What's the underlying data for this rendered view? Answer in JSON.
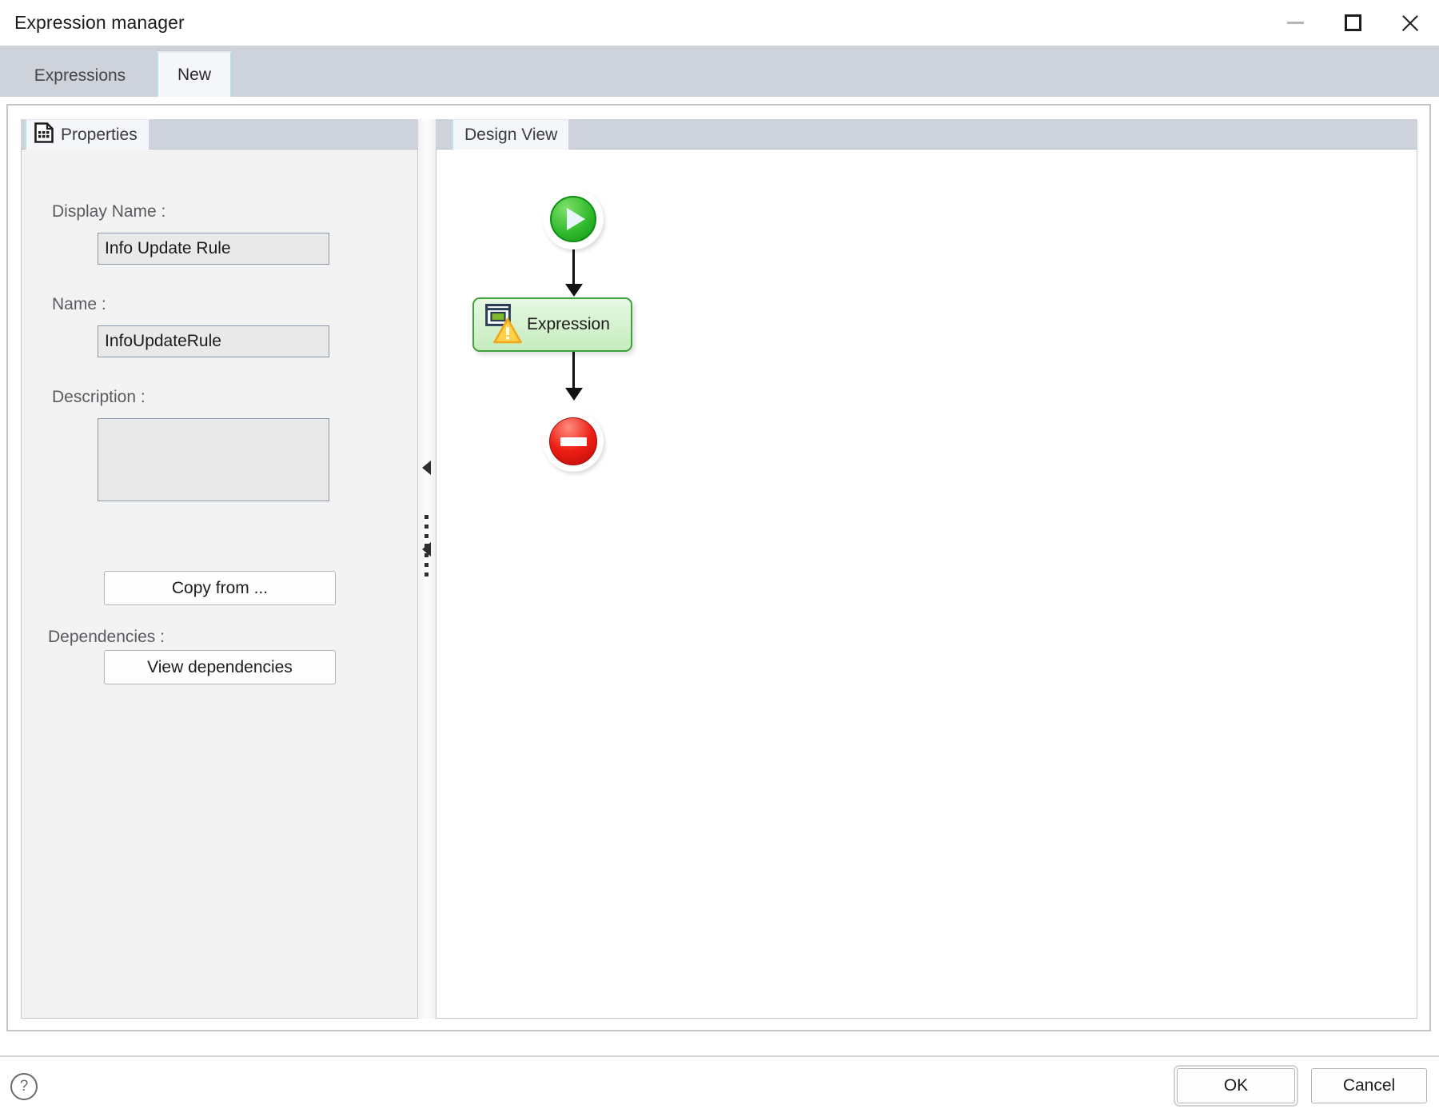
{
  "window": {
    "title": "Expression manager",
    "controls": {
      "minimize": "minimize-icon",
      "maximize": "maximize-icon",
      "close": "close-icon"
    }
  },
  "tabs": [
    {
      "label": "Expressions",
      "active": false
    },
    {
      "label": "New",
      "active": true
    }
  ],
  "properties_panel": {
    "tab_label": "Properties",
    "tab_icon": "document-grid-icon",
    "fields": {
      "display_name": {
        "label": "Display Name :",
        "value": "Info Update Rule",
        "placeholder": ""
      },
      "name": {
        "label": "Name :",
        "value": "InfoUpdateRule",
        "placeholder": ""
      },
      "description": {
        "label": "Description :",
        "value": "",
        "placeholder": ""
      }
    },
    "copy_from_button": "Copy from ...",
    "dependencies_label": "Dependencies :",
    "view_dependencies_button": "View dependencies"
  },
  "splitter": {
    "collapse_icon_top": "triangle-left-icon",
    "collapse_icon_bottom": "triangle-left-icon",
    "grip": "dotted-grip"
  },
  "design_panel": {
    "tab_label": "Design View",
    "flow": {
      "start_node": {
        "type": "start",
        "icon": "play-icon",
        "color": "#33bb2e"
      },
      "activity_node": {
        "type": "expression",
        "label": "Expression",
        "icon": "window-screen-icon",
        "warning_icon": "warning-triangle-icon",
        "color": "#3fa03c"
      },
      "end_node": {
        "type": "terminate",
        "icon": "stop-minus-icon",
        "color": "#ee1f14"
      }
    }
  },
  "footer": {
    "help_icon": "help-question-icon",
    "help_glyph": "?",
    "ok_button": "OK",
    "cancel_button": "Cancel"
  }
}
